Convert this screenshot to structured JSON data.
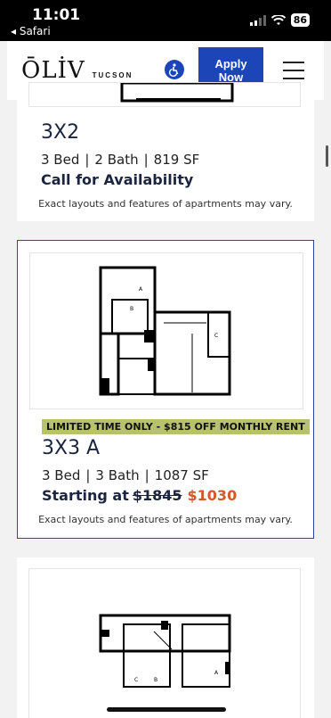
{
  "status_bar": {
    "time": "11:01",
    "back_label": "◂ Safari",
    "battery": "86",
    "icons": [
      "signal-icon",
      "wifi-icon",
      "battery-icon"
    ]
  },
  "header": {
    "logo": "ŌLİV",
    "logo_sub": "TUCSON",
    "apply_label": "Apply\nNow",
    "accessibility_icon": "accessibility-icon",
    "menu_icon": "hamburger-menu-icon",
    "accent_color": "#1c46b8"
  },
  "plans": [
    {
      "name": "3X2",
      "beds": "3 Bed",
      "baths": "2 Bath",
      "sqft": "819 SF",
      "availability": "Call for Availability",
      "disclaimer": "Exact layouts and features of apartments may vary."
    },
    {
      "promo": "LIMITED TIME ONLY - $815 OFF MONTHLY RENT",
      "name": "3X3 A",
      "beds": "3 Bed",
      "baths": "3 Bath",
      "sqft": "1087 SF",
      "price_prefix": "Starting at",
      "old_price": "$1845",
      "new_price": "$1030",
      "disclaimer": "Exact layouts and features of apartments may vary.",
      "room_labels": [
        "A",
        "B",
        "C"
      ]
    },
    {
      "room_labels": [
        "C",
        "B",
        "A"
      ]
    }
  ],
  "colors": {
    "price_accent": "#d15a2a",
    "promo_bg": "#b8c26e",
    "selected_border": "#2b46a3"
  }
}
